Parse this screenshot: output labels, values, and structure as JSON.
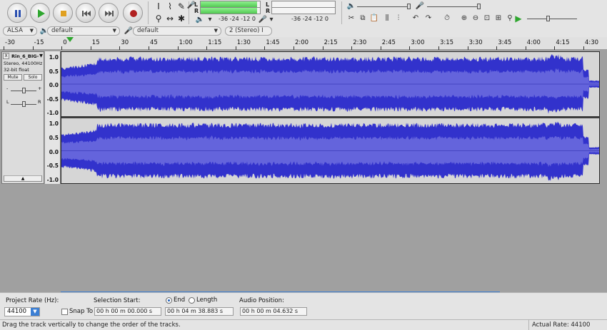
{
  "transport": {
    "pause": "pause-button",
    "play": "play-button",
    "stop": "stop-button",
    "skip_start": "skip-start-button",
    "skip_end": "skip-end-button",
    "record": "record-button"
  },
  "meters": {
    "record_L": "L",
    "record_R": "R",
    "record_scale": "-36  -24  -12  0",
    "play_L": "L",
    "play_R": "R",
    "play_scale": "-36  -24  -12  0",
    "play_level": 0.82
  },
  "device": {
    "host": "ALSA",
    "output": "default",
    "input": "default",
    "channels": "2 (Stereo) I"
  },
  "ruler": {
    "ticks": [
      "-30",
      "-15",
      "0",
      "15",
      "30",
      "45",
      "1:00",
      "1:15",
      "1:30",
      "1:45",
      "2:00",
      "2:15",
      "2:30",
      "2:45",
      "3:00",
      "3:15",
      "3:30",
      "3:45",
      "4:00",
      "4:15",
      "4:30"
    ]
  },
  "track": {
    "name": "Rin_6_BIG-",
    "info1": "Stereo, 44100Hz",
    "info2": "32-bit float",
    "mute": "Mute",
    "solo": "Solo",
    "gain_minus": "-",
    "gain_plus": "+",
    "pan_left": "L",
    "pan_right": "R",
    "close": "X",
    "collapse": "▲",
    "scale": [
      "1.0",
      "0.5",
      "0.0",
      "-0.5",
      "-1.0"
    ]
  },
  "selection": {
    "project_rate_label": "Project Rate (Hz):",
    "project_rate": "44100",
    "snap_to": "Snap To",
    "selection_start_label": "Selection Start:",
    "selection_start": "00 h 00 m 00.000 s",
    "end_label": "End",
    "length_label": "Length",
    "end_value": "00 h 04 m 38.883 s",
    "audio_position_label": "Audio Position:",
    "audio_position": "00 h 00 m 04.632 s"
  },
  "status": {
    "message": "Drag the track vertically to change the order of the tracks.",
    "actual_rate": "Actual Rate: 44100"
  },
  "colors": {
    "wave": "#3232cc",
    "wave_rms": "#6464dc",
    "play_button": "#2fa62f",
    "stop_button": "#e0a020",
    "record_button": "#b02020",
    "pause_button": "#2a4fb0"
  }
}
